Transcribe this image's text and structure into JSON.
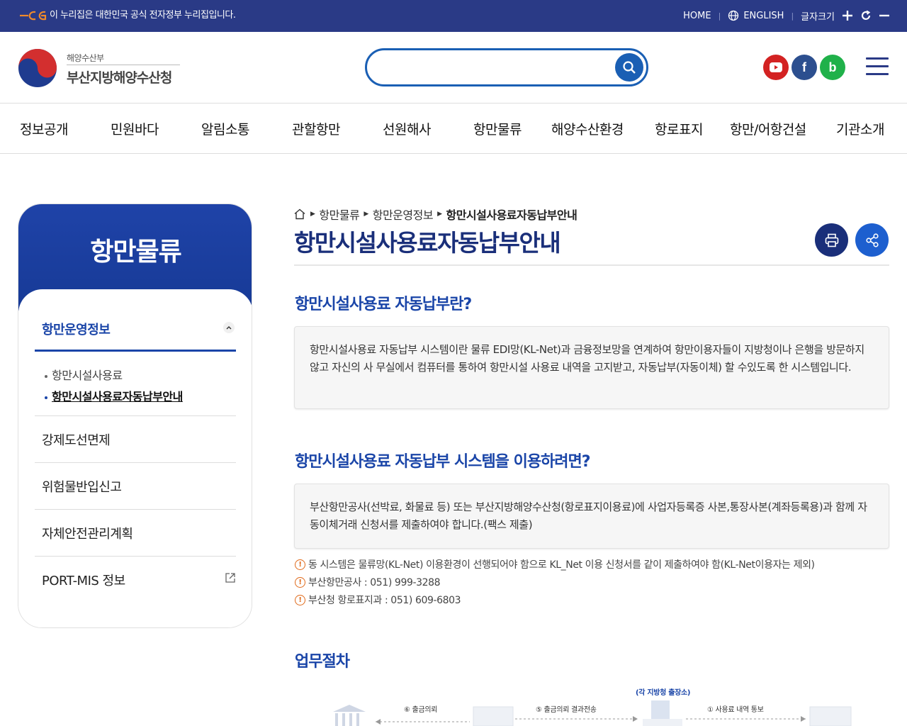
{
  "gov_bar": {
    "notice": "이 누리집은 대한민국 공식 전자정부 누리집입니다.",
    "home": "HOME",
    "english": "ENGLISH",
    "font_size": "글자크기"
  },
  "header": {
    "ministry": "해양수산부",
    "agency": "부산지방해양수산청",
    "search_placeholder": ""
  },
  "gnb": [
    "정보공개",
    "민원바다",
    "알림소통",
    "관할항만",
    "선원해사",
    "항만물류",
    "해양수산환경",
    "항로표지",
    "항만/어항건설",
    "기관소개"
  ],
  "sidebar": {
    "title": "항만물류",
    "selected": "항만운영정보",
    "sub_items": [
      "항만시설사용료",
      "항만시설사용료자동납부안내"
    ],
    "menus": [
      "강제도선면제",
      "위험물반입신고",
      "자체안전관리계획",
      "PORT-MIS 정보"
    ]
  },
  "breadcrumb": {
    "level1": "항만물류",
    "level2": "항만운영정보",
    "current": "항만시설사용료자동납부안내"
  },
  "page_title": "항만시설사용료자동납부안내",
  "sections": {
    "s1_heading": "항만시설사용료 자동납부란?",
    "s1_body": "항만시설사용료 자동납부 시스템이란 물류 EDI망(KL-Net)과 금융정보망을 연계하여 항만이용자들이 지방청이나 은행을 방문하지않고 자신의 사 무실에서 컴퓨터를 통하여 항만시설 사용료 내역을 고지받고, 자동납부(자동이체) 할 수있도록 한 시스템입니다.",
    "s2_heading": "항만시설사용료 자동납부 시스템을 이용하려면?",
    "s2_body": "부산항만공사(선박료, 화물료 등) 또는 부산지방해양수산청(항로표지이용료)에 사업자등록증 사본,통장사본(계좌등록용)과 함께 자동이체거래 신청서를 제출하여야 합니다.(팩스 제출)",
    "notes": [
      "동 시스템은 물류망(KL-Net) 이용환경이 선행되어야 함으로 KL_Net 이용 신청서를 같이 제출하여야 함(KL-Net이용자는 제외)",
      "부산항만공사 : 051) 999-3288",
      "부산청 항로표지과 : 051) 609-6803"
    ],
    "s3_heading": "업무절차"
  },
  "diagram": {
    "top_label": "(각 지방청 출장소)",
    "step_a": "⑥ 출금의뢰",
    "step_b": "⑤ 출금의뢰 결과전송",
    "step_c": "① 사용료 내역 통보"
  },
  "colors": {
    "gov_bar": "#2a3a86",
    "primary": "#1a45a8",
    "title": "#1a2f7a",
    "accent_share": "#1d5fcf"
  }
}
